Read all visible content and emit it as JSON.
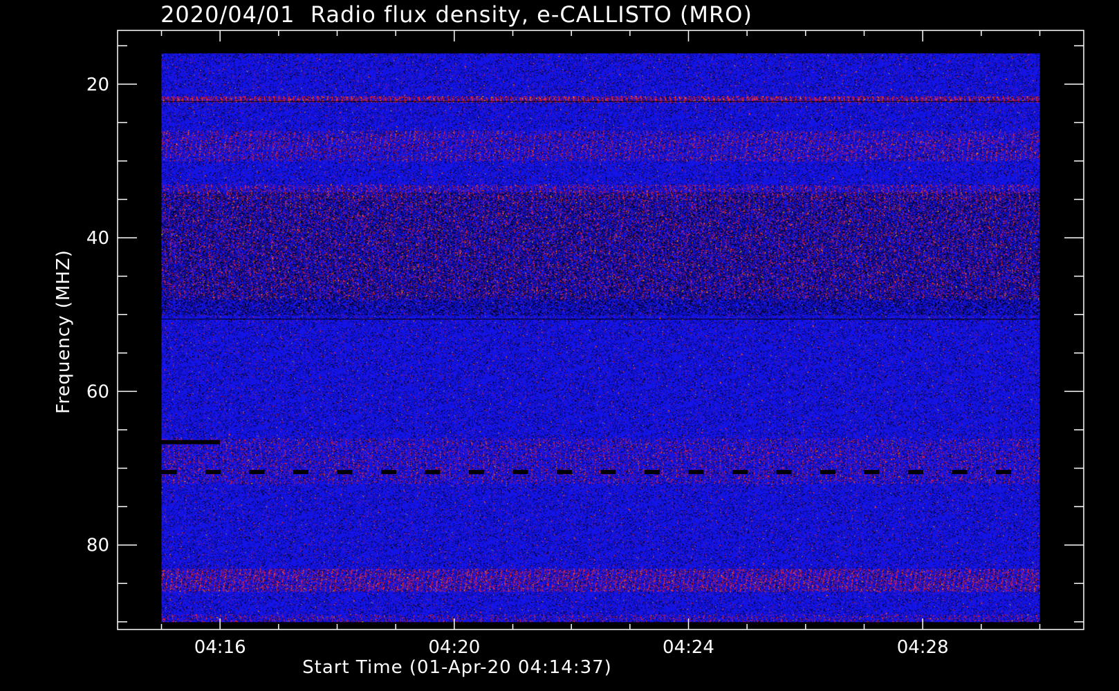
{
  "chart_data": {
    "type": "heatmap",
    "title": "2020/04/01  Radio flux density, e-CALLISTO (MRO)",
    "xlabel": "Start Time (01-Apr-20 04:14:37)",
    "ylabel": "Frequency (MHZ)",
    "x_ticks": [
      {
        "label": "04:16",
        "minute": 16
      },
      {
        "label": "04:20",
        "minute": 20
      },
      {
        "label": "04:24",
        "minute": 24
      },
      {
        "label": "04:28",
        "minute": 28
      }
    ],
    "y_ticks": [
      {
        "label": "20",
        "value": 20
      },
      {
        "label": "40",
        "value": 40
      },
      {
        "label": "60",
        "value": 60
      },
      {
        "label": "80",
        "value": 80
      }
    ],
    "xlim": [
      "04:14:15",
      "04:30:45"
    ],
    "ylim": [
      91,
      13
    ],
    "data_x_range": [
      "04:15",
      "04:30"
    ],
    "data_y_range": [
      16,
      90
    ],
    "colors": {
      "background": "#000000",
      "low": "#000000",
      "mid": "#1a1ae6",
      "high": "#ff3300",
      "peak": "#ffcc00"
    }
  }
}
